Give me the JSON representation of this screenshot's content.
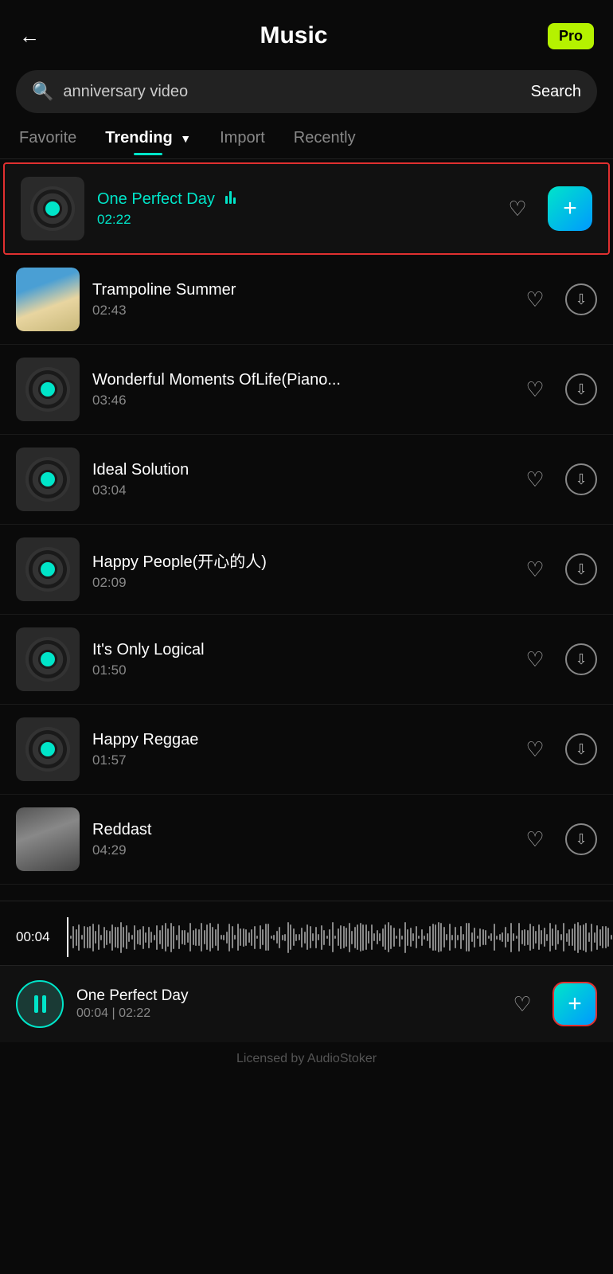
{
  "header": {
    "title": "Music",
    "pro_label": "Pro",
    "back_label": "←"
  },
  "search": {
    "placeholder": "anniversary video",
    "button_label": "Search"
  },
  "tabs": [
    {
      "id": "favorite",
      "label": "Favorite",
      "active": false
    },
    {
      "id": "trending",
      "label": "Trending",
      "active": true
    },
    {
      "id": "import",
      "label": "Import",
      "active": false
    },
    {
      "id": "recently",
      "label": "Recently",
      "active": false
    }
  ],
  "tracks": [
    {
      "id": 1,
      "name": "One Perfect Day",
      "duration": "02:22",
      "highlighted": true,
      "playing": true,
      "thumb_type": "vinyl"
    },
    {
      "id": 2,
      "name": "Trampoline Summer",
      "duration": "02:43",
      "highlighted": false,
      "playing": false,
      "thumb_type": "beach"
    },
    {
      "id": 3,
      "name": "Wonderful Moments OfLife(Piano...",
      "duration": "03:46",
      "highlighted": false,
      "playing": false,
      "thumb_type": "vinyl"
    },
    {
      "id": 4,
      "name": "Ideal Solution",
      "duration": "03:04",
      "highlighted": false,
      "playing": false,
      "thumb_type": "vinyl"
    },
    {
      "id": 5,
      "name": "Happy People(开心的人)",
      "duration": "02:09",
      "highlighted": false,
      "playing": false,
      "thumb_type": "vinyl"
    },
    {
      "id": 6,
      "name": "It's Only Logical",
      "duration": "01:50",
      "highlighted": false,
      "playing": false,
      "thumb_type": "vinyl"
    },
    {
      "id": 7,
      "name": "Happy Reggae",
      "duration": "01:57",
      "highlighted": false,
      "playing": false,
      "thumb_type": "vinyl"
    },
    {
      "id": 8,
      "name": "Reddast",
      "duration": "04:29",
      "highlighted": false,
      "playing": false,
      "thumb_type": "person"
    }
  ],
  "timeline": {
    "current_time": "00:04"
  },
  "now_playing": {
    "name": "One Perfect Day",
    "time": "00:04 | 02:22"
  },
  "footer": {
    "label": "Licensed by AudioStoker"
  }
}
